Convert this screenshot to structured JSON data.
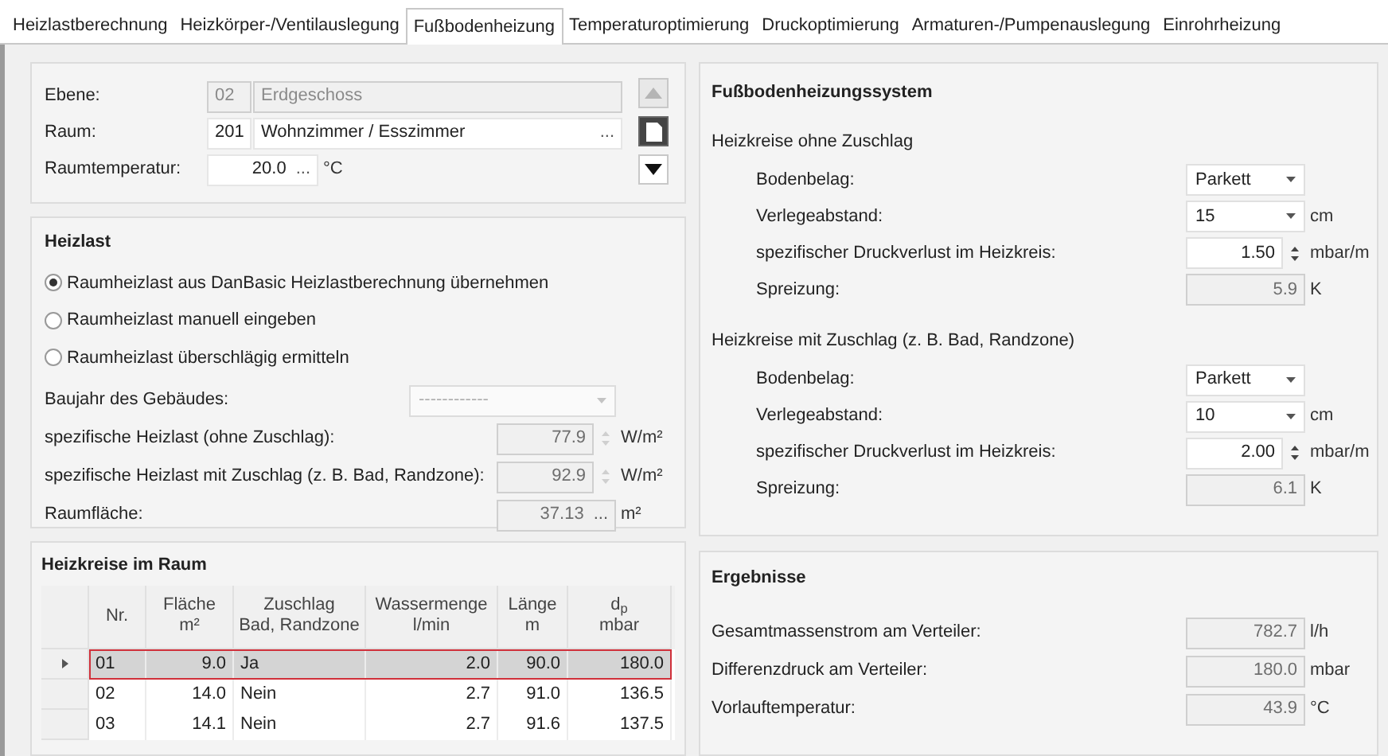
{
  "tabs": [
    {
      "label": "Heizlastberechnung",
      "selected": false
    },
    {
      "label": "Heizkörper-/Ventilauslegung",
      "selected": false
    },
    {
      "label": "Fußbodenheizung",
      "selected": true
    },
    {
      "label": "Temperaturoptimierung",
      "selected": false
    },
    {
      "label": "Druckoptimierung",
      "selected": false
    },
    {
      "label": "Armaturen-/Pumpenauslegung",
      "selected": false
    },
    {
      "label": "Einrohrheizung",
      "selected": false
    }
  ],
  "location": {
    "rows": [
      {
        "kind": "code",
        "label": "Ebene:",
        "code": "02",
        "name": "Erdgeschoss",
        "disabled": true
      },
      {
        "kind": "code",
        "label": "Raum:",
        "code": "201",
        "name": "Wohnzimmer / Esszimmer",
        "button": "...",
        "disabled": false
      },
      {
        "kind": "temp",
        "label": "Raumtemperatur:",
        "value": "20.0",
        "button": "...",
        "unit": "°C"
      }
    ]
  },
  "heizlast": {
    "title": "Heizlast",
    "options": [
      {
        "label": "Raumheizlast aus DanBasic Heizlastberechnung übernehmen",
        "selected": true
      },
      {
        "label": "Raumheizlast manuell eingeben",
        "selected": false
      },
      {
        "label": "Raumheizlast überschlägig ermitteln",
        "selected": false
      }
    ],
    "fields": [
      {
        "kind": "select",
        "label": "Baujahr des Gebäudes:",
        "value": "------------",
        "disabled": true
      },
      {
        "kind": "spin",
        "label": "spezifische Heizlast (ohne Zuschlag):",
        "value": "77.9",
        "unit": "W/m²",
        "disabled": true
      },
      {
        "kind": "spin",
        "label": "spezifische Heizlast mit Zuschlag (z. B. Bad, Randzone):",
        "value": "92.9",
        "unit": "W/m²",
        "disabled": true
      },
      {
        "kind": "browse",
        "label": "Raumfläche:",
        "value": "37.13",
        "button": "...",
        "unit": "m²",
        "disabled": true
      }
    ]
  },
  "system": {
    "title": "Fußbodenheizungssystem",
    "groups": [
      {
        "title": "Heizkreise ohne Zuschlag",
        "fields": [
          {
            "kind": "select",
            "label": "Bodenbelag:",
            "value": "Parkett",
            "disabled": false
          },
          {
            "kind": "select",
            "label": "Verlegeabstand:",
            "value": "15",
            "unit": "cm",
            "disabled": false
          },
          {
            "kind": "spin",
            "label": "spezifischer Druckverlust im Heizkreis:",
            "value": "1.50",
            "unit": "mbar/m",
            "disabled": false
          },
          {
            "kind": "readonly",
            "label": "Spreizung:",
            "value": "5.9",
            "unit": "K"
          }
        ]
      },
      {
        "title": "Heizkreise mit Zuschlag (z. B. Bad, Randzone)",
        "fields": [
          {
            "kind": "select",
            "label": "Bodenbelag:",
            "value": "Parkett",
            "disabled": false
          },
          {
            "kind": "select",
            "label": "Verlegeabstand:",
            "value": "10",
            "unit": "cm",
            "disabled": false
          },
          {
            "kind": "spin",
            "label": "spezifischer Druckverlust im Heizkreis:",
            "value": "2.00",
            "unit": "mbar/m",
            "disabled": false
          },
          {
            "kind": "readonly",
            "label": "Spreizung:",
            "value": "6.1",
            "unit": "K"
          }
        ]
      }
    ]
  },
  "circuits": {
    "title": "Heizkreise im Raum",
    "columns": [
      {
        "lines": [
          "Nr."
        ]
      },
      {
        "lines": [
          "Fläche",
          "m²"
        ]
      },
      {
        "lines": [
          "Zuschlag",
          "Bad, Randzone"
        ]
      },
      {
        "lines": [
          "Wassermenge",
          "l/min"
        ]
      },
      {
        "lines": [
          "Länge",
          "m"
        ]
      },
      {
        "lines": [
          "d$_{p}$",
          "mbar"
        ]
      }
    ],
    "rows": [
      {
        "cells": [
          "01",
          "9.0",
          "Ja",
          "2.0",
          "90.0",
          "180.0"
        ],
        "selected": true
      },
      {
        "cells": [
          "02",
          "14.0",
          "Nein",
          "2.7",
          "91.0",
          "136.5"
        ],
        "selected": false
      },
      {
        "cells": [
          "03",
          "14.1",
          "Nein",
          "2.7",
          "91.6",
          "137.5"
        ],
        "selected": false
      }
    ]
  },
  "results": {
    "title": "Ergebnisse",
    "fields": [
      {
        "kind": "readonly",
        "label": "Gesamtmassenstrom am Verteiler:",
        "value": "782.7",
        "unit": "l/h"
      },
      {
        "kind": "readonly",
        "label": "Differenzdruck am Verteiler:",
        "value": "180.0",
        "unit": "mbar"
      },
      {
        "kind": "readonly",
        "label": "Vorlauftemperatur:",
        "value": "43.9",
        "unit": "°C"
      }
    ]
  }
}
